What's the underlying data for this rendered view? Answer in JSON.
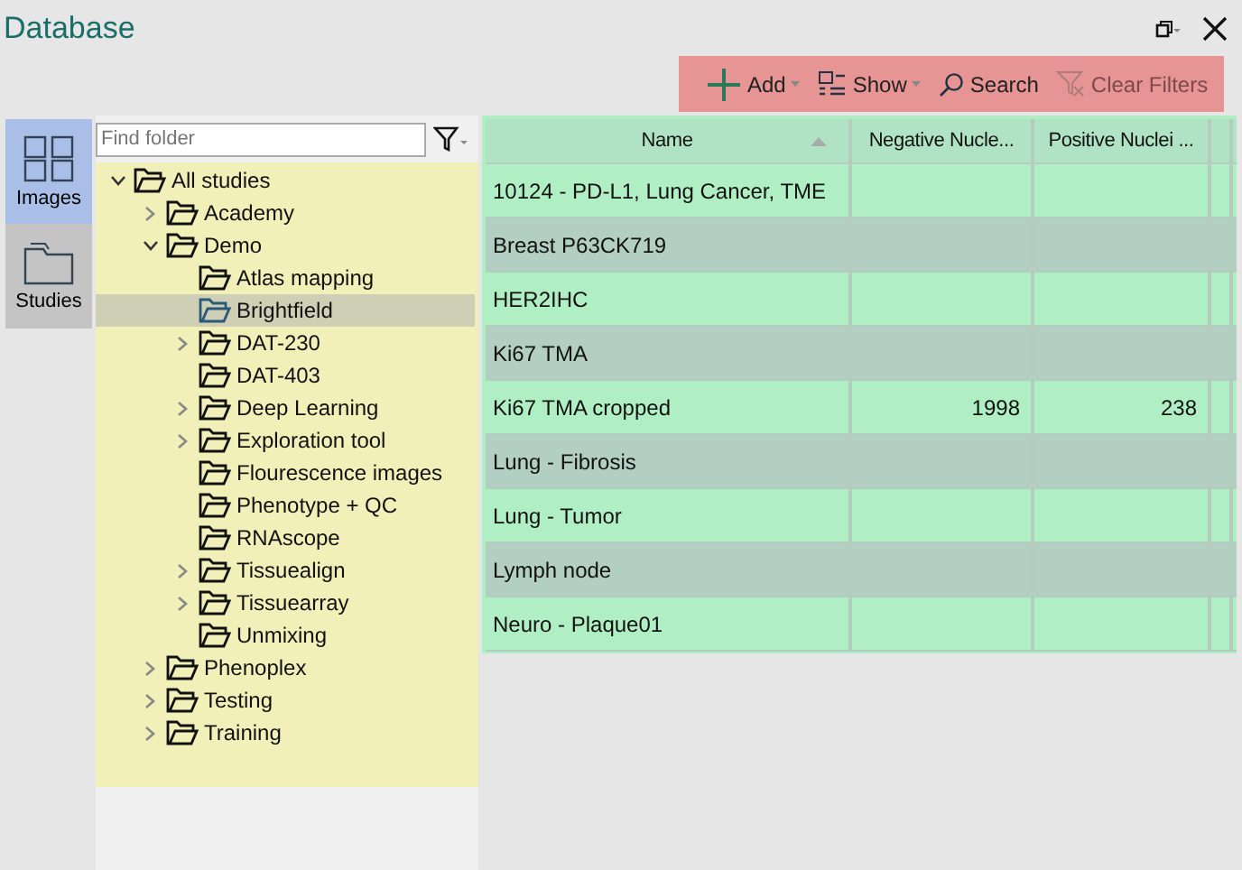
{
  "window": {
    "title": "Database"
  },
  "toolbar": [
    {
      "kind": "add",
      "label": "Add",
      "dropdown": true,
      "disabled": false
    },
    {
      "kind": "show",
      "label": "Show",
      "dropdown": true,
      "disabled": false
    },
    {
      "kind": "search",
      "label": "Search",
      "dropdown": false,
      "disabled": false
    },
    {
      "kind": "clear",
      "label": "Clear Filters",
      "dropdown": false,
      "disabled": true
    }
  ],
  "rail": [
    {
      "kind": "images",
      "label": "Images",
      "selected": true
    },
    {
      "kind": "studies",
      "label": "Studies",
      "selected": false
    }
  ],
  "folder_search": {
    "placeholder": "Find folder"
  },
  "tree": [
    {
      "label": "All studies",
      "expanded": true,
      "selected": false,
      "children": [
        {
          "label": "Academy",
          "expanded": false,
          "expandable": true,
          "selected": false
        },
        {
          "label": "Demo",
          "expanded": true,
          "selected": false,
          "children": [
            {
              "label": "Atlas mapping",
              "expandable": false,
              "selected": false
            },
            {
              "label": "Brightfield",
              "expandable": false,
              "selected": true
            },
            {
              "label": "DAT-230",
              "expandable": true,
              "expanded": false,
              "selected": false
            },
            {
              "label": "DAT-403",
              "expandable": false,
              "selected": false
            },
            {
              "label": "Deep Learning",
              "expandable": true,
              "expanded": false,
              "selected": false
            },
            {
              "label": "Exploration tool",
              "expandable": true,
              "expanded": false,
              "selected": false
            },
            {
              "label": "Flourescence images",
              "expandable": false,
              "selected": false
            },
            {
              "label": "Phenotype + QC",
              "expandable": false,
              "selected": false
            },
            {
              "label": "RNAscope",
              "expandable": false,
              "selected": false
            },
            {
              "label": "Tissuealign",
              "expandable": true,
              "expanded": false,
              "selected": false
            },
            {
              "label": "Tissuearray",
              "expandable": true,
              "expanded": false,
              "selected": false
            },
            {
              "label": "Unmixing",
              "expandable": false,
              "selected": false
            }
          ]
        },
        {
          "label": "Phenoplex",
          "expandable": true,
          "expanded": false,
          "selected": false
        },
        {
          "label": "Testing",
          "expandable": true,
          "expanded": false,
          "selected": false
        },
        {
          "label": "Training",
          "expandable": true,
          "expanded": false,
          "selected": false
        }
      ]
    }
  ],
  "table": {
    "columns": [
      "Name",
      "Negative Nucle...",
      "Positive Nuclei ..."
    ],
    "rows": [
      [
        "10124 - PD-L1, Lung Cancer, TME",
        "",
        ""
      ],
      [
        "Breast P63CK719",
        "",
        ""
      ],
      [
        "HER2IHC",
        "",
        ""
      ],
      [
        "Ki67 TMA",
        "",
        ""
      ],
      [
        "Ki67 TMA cropped",
        "1998",
        "238"
      ],
      [
        "Lung - Fibrosis",
        "",
        ""
      ],
      [
        "Lung - Tumor",
        "",
        ""
      ],
      [
        "Lymph node",
        "",
        ""
      ],
      [
        "Neuro - Plaque01",
        "",
        ""
      ]
    ]
  }
}
